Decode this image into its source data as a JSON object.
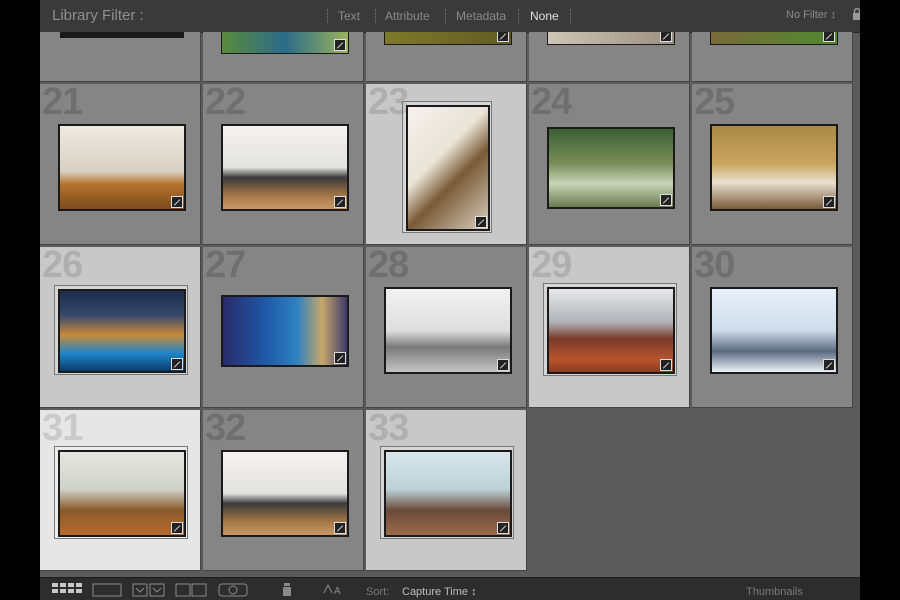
{
  "filter_bar": {
    "title": "Library Filter :",
    "items": [
      {
        "label": "Text"
      },
      {
        "label": "Attribute"
      },
      {
        "label": "Metadata"
      },
      {
        "label": "None"
      }
    ],
    "active_item": "None",
    "preset": "No Filter ↕"
  },
  "grid": {
    "cells": [
      {
        "number": "21",
        "selected": "none",
        "scene": "dining"
      },
      {
        "number": "22",
        "selected": "none",
        "scene": "living-bright"
      },
      {
        "number": "23",
        "selected": "light",
        "scene": "stairs"
      },
      {
        "number": "24",
        "selected": "none",
        "scene": "bedroom-green"
      },
      {
        "number": "25",
        "selected": "none",
        "scene": "bedroom-warm"
      },
      {
        "number": "26",
        "selected": "light",
        "scene": "pool-night"
      },
      {
        "number": "27",
        "selected": "none",
        "scene": "blue-room"
      },
      {
        "number": "28",
        "selected": "none",
        "scene": "open-white"
      },
      {
        "number": "29",
        "selected": "light",
        "scene": "dining-wood"
      },
      {
        "number": "30",
        "selected": "none",
        "scene": "kitchen-white"
      },
      {
        "number": "31",
        "selected": "white",
        "scene": "foyer"
      },
      {
        "number": "32",
        "selected": "none",
        "scene": "living-bright"
      },
      {
        "number": "33",
        "selected": "light",
        "scene": "living-teal"
      }
    ]
  },
  "toolbar": {
    "sort_label": "Sort:",
    "sort_value": "Capture Time ↕",
    "thumbnails_label": "Thumbnails"
  },
  "colors": {
    "panel": "#5b5b5b",
    "cell": "#858585",
    "cell_selected": "#c8c8c8",
    "cell_primary": "#e6e6e6",
    "filter_bar": "#3a3a3a"
  }
}
